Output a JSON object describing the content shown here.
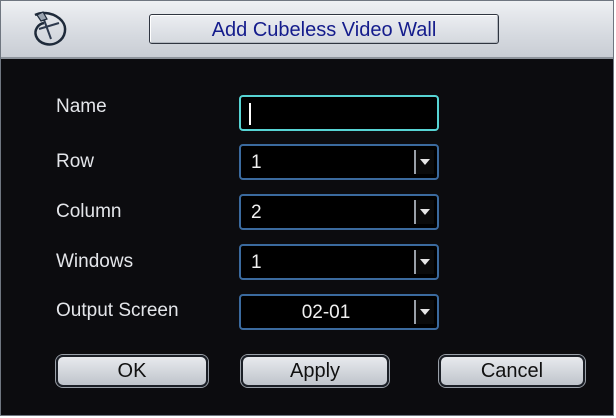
{
  "dialog": {
    "title": "Add Cubeless Video Wall",
    "logo_icon": "dahua-logo-icon"
  },
  "form": {
    "name_label": "Name",
    "name_value": "",
    "row_label": "Row",
    "row_value": "1",
    "column_label": "Column",
    "column_value": "2",
    "windows_label": "Windows",
    "windows_value": "1",
    "output_label": "Output Screen",
    "output_value": "02-01"
  },
  "buttons": {
    "ok": "OK",
    "apply": "Apply",
    "cancel": "Cancel"
  },
  "colors": {
    "background": "#0c0c0f",
    "title_text": "#141c8c",
    "field_border": "#3b6a9e",
    "focus_border": "#57d4d4"
  }
}
